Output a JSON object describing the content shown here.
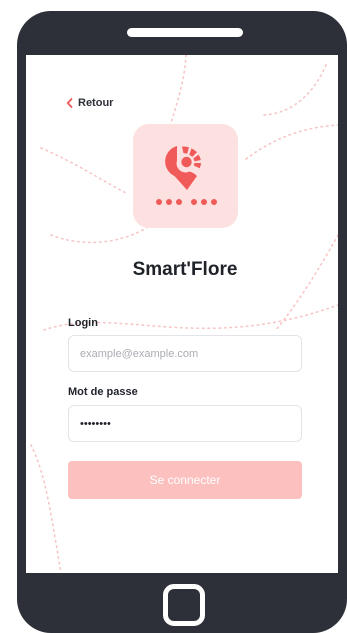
{
  "nav": {
    "back_label": "Retour"
  },
  "app": {
    "name": "Smart'Flore"
  },
  "login": {
    "label": "Login",
    "placeholder": "example@example.com",
    "value": ""
  },
  "password": {
    "label": "Mot de passe",
    "value": "********"
  },
  "submit": {
    "label": "Se connecter"
  },
  "icons": {
    "back": "chevron-left-icon",
    "logo": "map-pin-chart-icon",
    "home": "home-button-icon"
  },
  "colors": {
    "frame": "#2d3038",
    "accent": "#f05a58",
    "logo_background": "#fde1e1",
    "button": "#fcc0bf",
    "decor_dots": "#f6c6c6"
  }
}
